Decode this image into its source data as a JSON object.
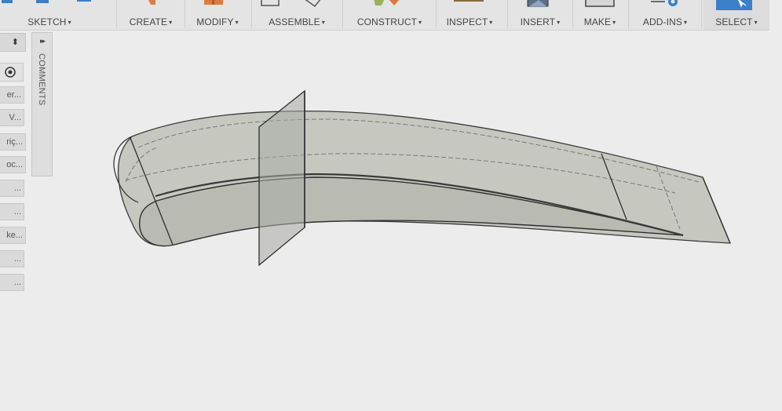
{
  "toolbar": {
    "groups": [
      {
        "label": "SKETCH"
      },
      {
        "label": "CREATE"
      },
      {
        "label": "MODIFY"
      },
      {
        "label": "ASSEMBLE"
      },
      {
        "label": "CONSTRUCT"
      },
      {
        "label": "INSPECT"
      },
      {
        "label": "INSERT"
      },
      {
        "label": "MAKE"
      },
      {
        "label": "ADD-INS"
      },
      {
        "label": "SELECT"
      }
    ],
    "caret": "▾"
  },
  "browser": {
    "items": [
      {
        "label": "er..."
      },
      {
        "label": "V..."
      },
      {
        "label": "riç..."
      },
      {
        "label": "oc..."
      },
      {
        "label": "..."
      },
      {
        "label": "..."
      },
      {
        "label": "ke..."
      },
      {
        "label": "..."
      },
      {
        "label": "..."
      }
    ]
  },
  "comments": {
    "label": "COMMENTS",
    "collapse_glyph": "▸▸"
  },
  "colors": {
    "body_fill": "#c6c8c0",
    "body_edge": "#3a3a3a",
    "plane_fill": "#a9aba6",
    "viewport_bg": "#ececec",
    "select_blue": "#3a7fc8"
  }
}
